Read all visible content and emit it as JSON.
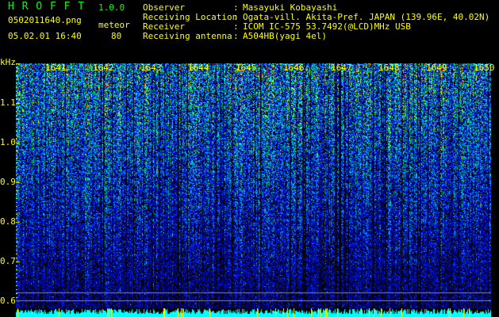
{
  "header": {
    "app_name": "H R O F F T",
    "version": "1.0.0",
    "filename": "0502011640.png",
    "datetime": "05.02.01 16:40",
    "mode_label": "meteor",
    "mode_value": "80"
  },
  "info": [
    {
      "label": "Observer",
      "value": "Masayuki Kobayashi"
    },
    {
      "label": "Receiving Location",
      "value": "Ogata-vill. Akita-Pref. JAPAN (139.96E, 40.02N)"
    },
    {
      "label": "Receiver",
      "value": "ICOM IC-575 53.7492(@LCD)MHz USB"
    },
    {
      "label": "Receiving antenna",
      "value": "A504HB(yagi 4el)"
    }
  ],
  "chart_data": {
    "type": "heatmap",
    "ylabel": "kHz",
    "ylim": [
      0.6,
      1.2
    ],
    "yticks": [
      "1.1",
      "1.0",
      "0.9",
      "0.8",
      "0.7",
      "0.6"
    ],
    "xticks": [
      "1641",
      "1642",
      "1643",
      "1644",
      "1645",
      "1646",
      "1647",
      "1648",
      "1649",
      "1650"
    ],
    "colormap": [
      "#000000",
      "#0000c0",
      "#0040ff",
      "#00c0ff",
      "#00ff80",
      "#ffff00",
      "#ff0000"
    ],
    "reference_lines_khz": [
      0.62,
      0.6
    ],
    "bottom_bar_colors": {
      "level": "#00ffff",
      "spike": "#ffff00"
    }
  },
  "colors": {
    "text": "#ffff00",
    "title": "#00ff00",
    "background": "#000000"
  }
}
